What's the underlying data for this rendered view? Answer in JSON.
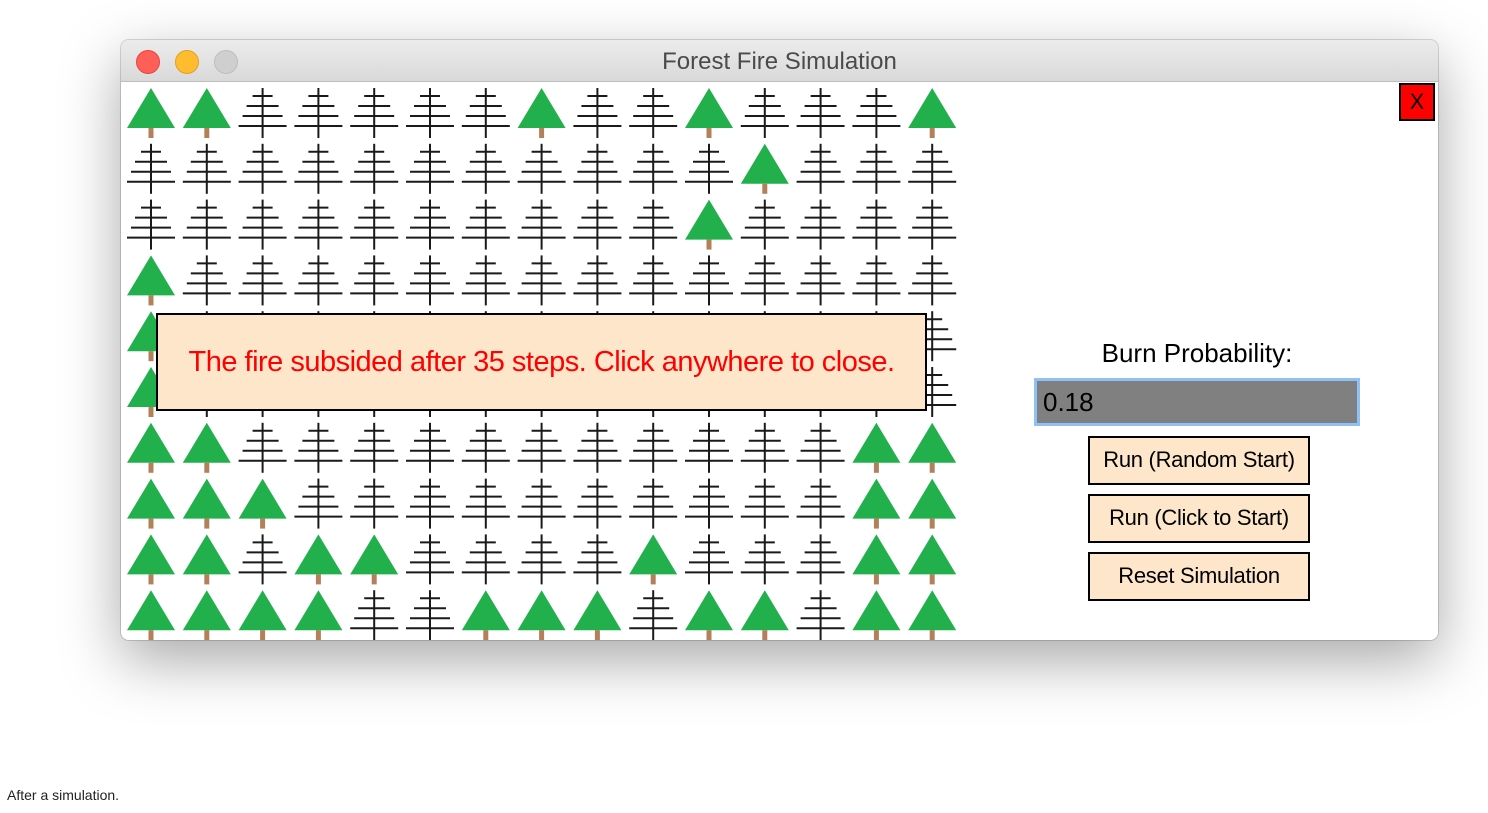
{
  "window": {
    "title": "Forest Fire Simulation",
    "close_label": "X"
  },
  "forest": {
    "legend": {
      "T": "live-tree",
      "B": "burnt-tree"
    },
    "rows": [
      "TTBBBBBTBBTBBBT",
      "BBBBBBBBBBBTBBB",
      "BBBBBBBBBBTBBBB",
      "TBBBBBBBBBBBBBB",
      "TBBBBBBBBBBBBBB",
      "TBBBBBBBBBBBBBB",
      "TTBBBBBBBBBBBTT",
      "TTTBBBBBBBBBBTT",
      "TTBTTBBBBTBBBTT",
      "TTTTBBTTTBTTBTT"
    ],
    "colors": {
      "live": "#22b04c",
      "trunk": "#b4805a",
      "burnt": "#1a1a1a"
    }
  },
  "message": {
    "text": "The fire subsided after 35 steps. Click anywhere to close."
  },
  "controls": {
    "burn_label": "Burn Probability:",
    "burn_value": "0.18",
    "run_random_label": "Run (Random Start)",
    "run_click_label": "Run (Click to Start)",
    "reset_label": "Reset Simulation"
  },
  "caption": "After a simulation."
}
